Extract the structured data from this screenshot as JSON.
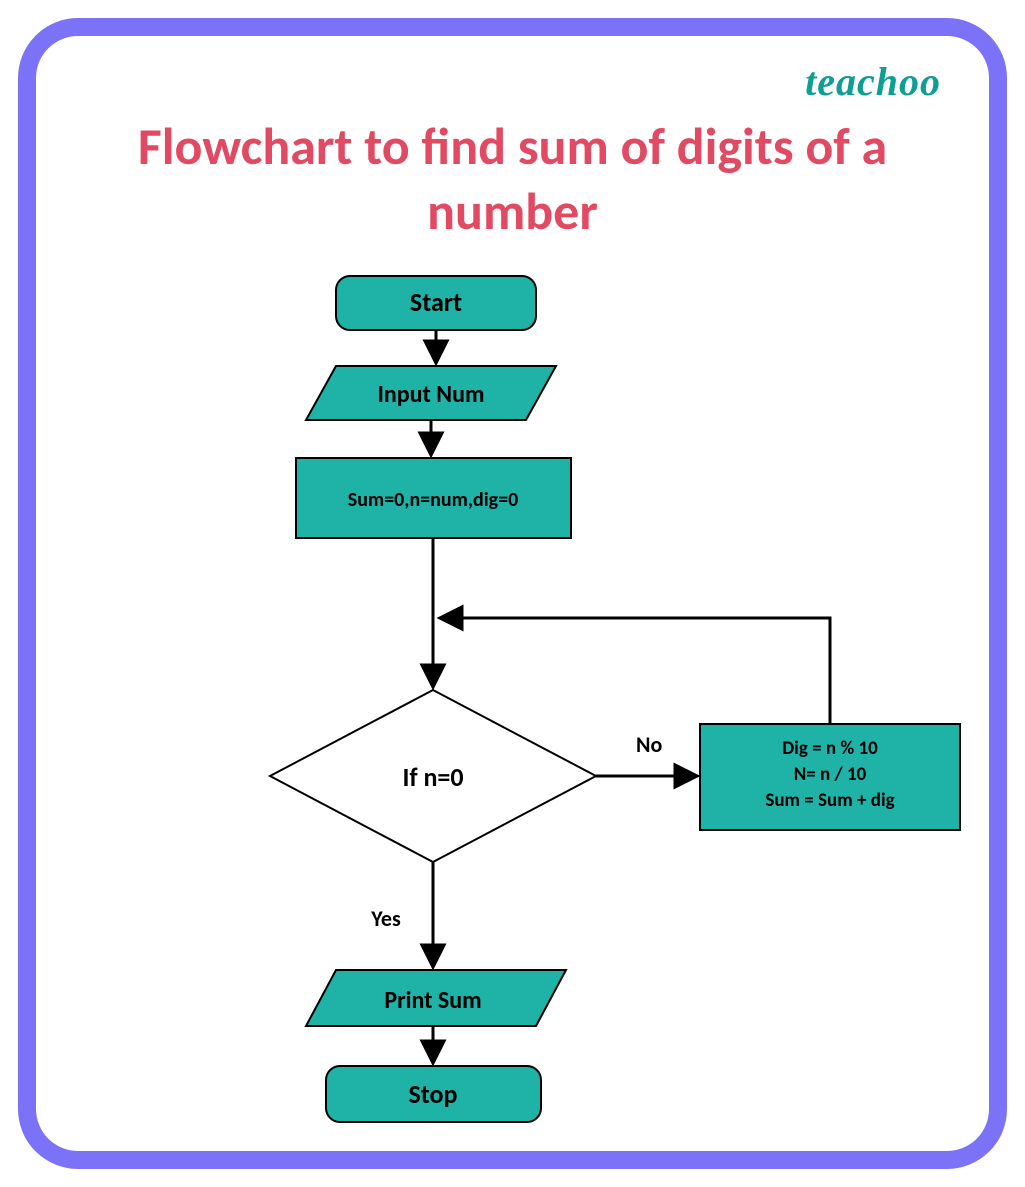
{
  "brand": "teachoo",
  "title": "Flowchart to find sum of digits of a number",
  "flow": {
    "start": "Start",
    "input": "Input Num",
    "init": "Sum=0,n=num,dig=0",
    "decision": "If  n=0",
    "decision_no": "No",
    "decision_yes": "Yes",
    "loop_line1": "Dig = n % 10",
    "loop_line2": "N= n / 10",
    "loop_line3": "Sum =  Sum + dig",
    "output": "Print Sum",
    "stop": "Stop"
  },
  "colors": {
    "shape_fill": "#1fb2a6",
    "shape_stroke": "#000000",
    "frame": "#7b72f7",
    "title": "#e14a62",
    "brand": "#0f9e93"
  }
}
